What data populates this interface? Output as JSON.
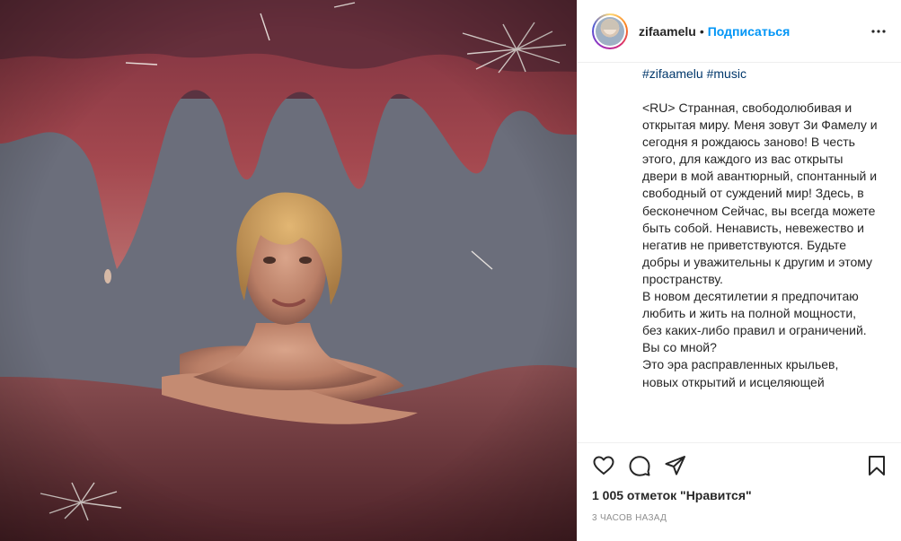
{
  "post": {
    "image_alt": "Photo of a woman with short blonde hair bathing under pink petal shapes",
    "colors": {
      "accent": "#0095f6",
      "hashtag": "#00376b",
      "text": "#262626",
      "muted": "#8e8e8e"
    }
  },
  "header": {
    "username": "zifaamelu",
    "separator": "•",
    "follow_label": "Подписаться",
    "more_icon": "more-horizontal-icon"
  },
  "caption": {
    "hashtags": [
      "#zifaamelu",
      "#music"
    ],
    "text": "<RU> Странная, свободолюбивая и открытая миру. Меня зовут Зи Фамелу и сегодня я рождаюсь заново! В честь этого, для каждого из вас открыты двери в мой авантюрный, спонтанный и свободный от суждений мир! Здесь, в бесконечном Сейчас, вы всегда можете быть собой. Ненависть, невежество и негатив не приветствуются. Будьте добры и уважительны к другим и этому пространству.\nВ новом десятилетии я предпочитаю любить и жить на полной мощности, без каких-либо правил и ограничений. Вы со мной?\nЭто эра расправленных крыльев, новых открытий и исцеляющей"
  },
  "actions": {
    "like_icon": "heart-icon",
    "comment_icon": "comment-icon",
    "share_icon": "share-icon",
    "save_icon": "bookmark-icon",
    "likes_text": "1 005 отметок \"Нравится\"",
    "timestamp": "3 ЧАСОВ НАЗАД"
  }
}
